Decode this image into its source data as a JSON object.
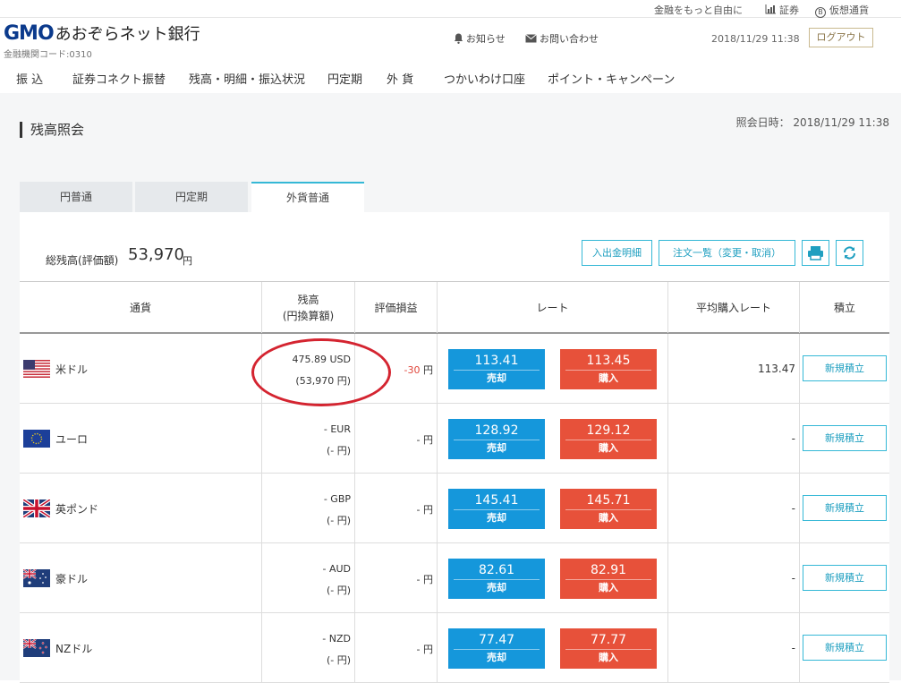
{
  "util_bar": {
    "tagline": "金融をもっと自由に",
    "securities": "証券",
    "crypto": "仮想通貨",
    "crypto_icon_glyph": "B"
  },
  "header": {
    "logo_mark": "GMO",
    "logo_name": "あおぞらネット銀行",
    "bank_code": "金融機関コード:0310",
    "notifications": "お知らせ",
    "contact": "お問い合わせ",
    "datetime": "2018/11/29 11:38",
    "logout": "ログアウト"
  },
  "nav": {
    "items": [
      "振 込",
      "証券コネクト振替",
      "残高・明細・振込状況",
      "円定期",
      "外 貨",
      "つかいわけ口座",
      "ポイント・キャンペーン"
    ]
  },
  "page": {
    "title": "残高照会",
    "inquiry_date": "照会日時： 2018/11/29 11:38"
  },
  "tabs": [
    "円普通",
    "円定期",
    "外貨普通"
  ],
  "summary": {
    "label": "総残高(評価額)",
    "value": "53,970",
    "unit": "円",
    "buttons": [
      "入出金明細",
      "注文一覧（変更・取消）"
    ]
  },
  "table": {
    "headers": {
      "currency": "通貨",
      "balance_line1": "残高",
      "balance_line2": "(円換算額)",
      "pl": "評価損益",
      "rate": "レート",
      "avg_rate": "平均購入レート",
      "savings": "積立"
    },
    "sell_label": "売却",
    "buy_label": "購入",
    "rows": [
      {
        "name": "米ドル",
        "flag": "us",
        "bal1": "475.89 USD",
        "bal2": "(53,970 円)",
        "pl_num": "-30",
        "pl_unit": " 円",
        "sell": "113.41",
        "buy": "113.45",
        "avg": "113.47",
        "savings": "新規積立"
      },
      {
        "name": "ユーロ",
        "flag": "eu",
        "bal1": "- EUR",
        "bal2": "(- 円)",
        "pl_num": "-",
        "pl_unit": " 円",
        "sell": "128.92",
        "buy": "129.12",
        "avg": "-",
        "savings": "新規積立"
      },
      {
        "name": "英ポンド",
        "flag": "uk",
        "bal1": "- GBP",
        "bal2": "(- 円)",
        "pl_num": "-",
        "pl_unit": " 円",
        "sell": "145.41",
        "buy": "145.71",
        "avg": "-",
        "savings": "新規積立"
      },
      {
        "name": "豪ドル",
        "flag": "au",
        "bal1": "- AUD",
        "bal2": "(- 円)",
        "pl_num": "-",
        "pl_unit": " 円",
        "sell": "82.61",
        "buy": "82.91",
        "avg": "-",
        "savings": "新規積立"
      },
      {
        "name": "NZドル",
        "flag": "nz",
        "bal1": "- NZD",
        "bal2": "(- 円)",
        "pl_num": "-",
        "pl_unit": " 円",
        "sell": "77.47",
        "buy": "77.77",
        "avg": "-",
        "savings": "新規積立"
      }
    ]
  },
  "colors": {
    "accent": "#35b8d6",
    "sell": "#1597db",
    "buy": "#e7513a",
    "negative": "#e0453a",
    "annotation": "#d42430"
  }
}
